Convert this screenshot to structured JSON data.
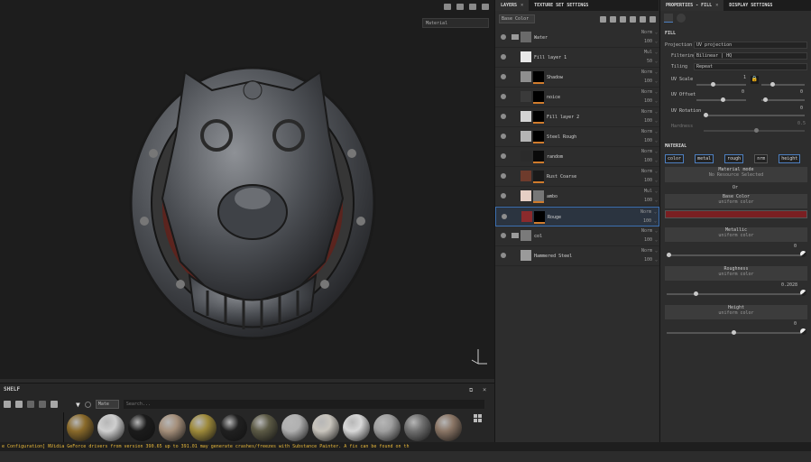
{
  "viewport": {
    "mode": "Material"
  },
  "shelf": {
    "title": "SHELF",
    "filter": "Mate",
    "search_placeholder": "Search..."
  },
  "status": {
    "message": "e Configuration] NVidia GeForce drivers from version 390.65 up to 391.01 may generate crashes/freezes with Substance Painter. A fix can be found on th"
  },
  "layers": {
    "tab_label": "LAYERS",
    "tab2_label": "TEXTURE SET SETTINGS",
    "channel": "Base Color",
    "rows": [
      {
        "name": "Water",
        "blend": "Norm",
        "opacity": "100",
        "folder": true,
        "t1": "#6a6a6a",
        "t2": ""
      },
      {
        "name": "Fill layer 1",
        "blend": "Mul",
        "opacity": "50",
        "t1": "#e8e8e8",
        "t2": ""
      },
      {
        "name": "Shadow",
        "blend": "Norm",
        "opacity": "100",
        "t1": "#8e8e8e",
        "t2": "#000000"
      },
      {
        "name": "noice",
        "blend": "Norm",
        "opacity": "100",
        "t1": "#3a3a3a",
        "t2": "#000000"
      },
      {
        "name": "Fill layer 2",
        "blend": "Norm",
        "opacity": "100",
        "t1": "#d4d4d4",
        "t2": "#000000"
      },
      {
        "name": "Steel Rough",
        "blend": "Norm",
        "opacity": "100",
        "t1": "#b5b5b5",
        "t2": "#000000"
      },
      {
        "name": "random",
        "blend": "Norm",
        "opacity": "100",
        "t1": "#2b2b2b",
        "t2": "#0a0a0a"
      },
      {
        "name": "Rust Coarse",
        "blend": "Norm",
        "opacity": "100",
        "t1": "#6e3b2c",
        "t2": "#1a1a1a"
      },
      {
        "name": "ambo",
        "blend": "Mul",
        "opacity": "100",
        "t1": "#e6cfc5",
        "t2": "#777777"
      },
      {
        "name": "Rouge",
        "blend": "Norm",
        "opacity": "100",
        "t1": "#8b2a2c",
        "t2": "#000000",
        "selected": true
      },
      {
        "name": "col",
        "blend": "Norm",
        "opacity": "100",
        "folder": true,
        "t1": "#7a7a7a",
        "t2": ""
      },
      {
        "name": "Hammered Steel",
        "blend": "Norm",
        "opacity": "100",
        "t1": "#9a9a9a",
        "t2": ""
      }
    ]
  },
  "props": {
    "tab_label": "PROPERTIES - FILL",
    "tab2_label": "DISPLAY SETTINGS",
    "fill_title": "FILL",
    "projection_label": "Projection",
    "projection": "UV projection",
    "filtering_label": "Filtering",
    "filtering": "Bilinear | HQ",
    "tiling_label": "Tiling",
    "tiling": "Repeat",
    "uvscale_label": "UV Scale",
    "uvscale_val": "1",
    "uvoffset_label": "UV Offset",
    "uvoffset_a": "0",
    "uvoffset_b": "0",
    "uvrot_label": "UV Rotation",
    "uvrot_val": "0",
    "hardness_label": "Hardness",
    "hardness_val": "0.5",
    "material_title": "MATERIAL",
    "chips": [
      "color",
      "metal",
      "rough",
      "nrm",
      "height"
    ],
    "matmode_label": "Material mode",
    "matmode_sub": "No Resource Selected",
    "or_label": "Or",
    "base_label": "Base Color",
    "base_sub": "uniform color",
    "base_color": "#7a1f22",
    "metal_label": "Metallic",
    "metal_sub": "uniform color",
    "metal_val": "0",
    "rough_label": "Roughness",
    "rough_sub": "uniform color",
    "rough_val": "0.2028",
    "height_label": "Height",
    "height_sub": "uniform color",
    "height_val": "0"
  },
  "materials": [
    "#8a6a2a",
    "#cfcfcf",
    "#1b1b1b",
    "#a58f7a",
    "#9e8a3a",
    "#202020",
    "#5c5a45",
    "#b0b0b0",
    "#c9c5bd",
    "#d8d8d8",
    "#9f9f9f",
    "#707070",
    "#8a7565"
  ]
}
